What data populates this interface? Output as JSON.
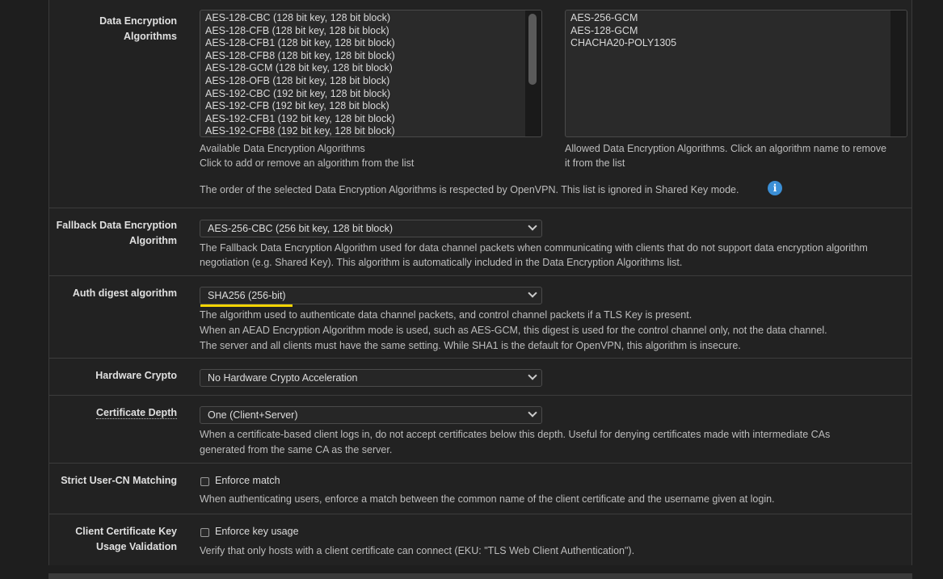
{
  "data_encryption": {
    "label": "Data Encryption Algorithms",
    "available": [
      "AES-128-CBC (128 bit key, 128 bit block)",
      "AES-128-CFB (128 bit key, 128 bit block)",
      "AES-128-CFB1 (128 bit key, 128 bit block)",
      "AES-128-CFB8 (128 bit key, 128 bit block)",
      "AES-128-GCM (128 bit key, 128 bit block)",
      "AES-128-OFB (128 bit key, 128 bit block)",
      "AES-192-CBC (192 bit key, 128 bit block)",
      "AES-192-CFB (192 bit key, 128 bit block)",
      "AES-192-CFB1 (192 bit key, 128 bit block)",
      "AES-192-CFB8 (192 bit key, 128 bit block)"
    ],
    "allowed": [
      "AES-256-GCM",
      "AES-128-GCM",
      "CHACHA20-POLY1305"
    ],
    "available_help_1": "Available Data Encryption Algorithms",
    "available_help_2": "Click to add or remove an algorithm from the list",
    "allowed_help_1": "Allowed Data Encryption Algorithms. Click an algorithm name to remove",
    "allowed_help_2": "it from the list",
    "order_note": "The order of the selected Data Encryption Algorithms is respected by OpenVPN. This list is ignored in Shared Key mode.",
    "info_icon": "i"
  },
  "fallback": {
    "label_1": "Fallback Data Encryption",
    "label_2": "Algorithm",
    "value": "AES-256-CBC (256 bit key, 128 bit block)",
    "help_1": "The Fallback Data Encryption Algorithm used for data channel packets when communicating with clients that do not support data encryption algorithm",
    "help_2": "negotiation (e.g. Shared Key). This algorithm is automatically included in the Data Encryption Algorithms list."
  },
  "auth_digest": {
    "label": "Auth digest algorithm",
    "value": "SHA256 (256-bit)",
    "help_1": "The algorithm used to authenticate data channel packets, and control channel packets if a TLS Key is present.",
    "help_2": "When an AEAD Encryption Algorithm mode is used, such as AES-GCM, this digest is used for the control channel only, not the data channel.",
    "help_3": "The server and all clients must have the same setting. While SHA1 is the default for OpenVPN, this algorithm is insecure."
  },
  "hardware_crypto": {
    "label": "Hardware Crypto",
    "value": "No Hardware Crypto Acceleration"
  },
  "cert_depth": {
    "label": "Certificate Depth",
    "value": "One (Client+Server)",
    "help_1": "When a certificate-based client logs in, do not accept certificates below this depth. Useful for denying certificates made with intermediate CAs",
    "help_2": "generated from the same CA as the server."
  },
  "strict_cn": {
    "label": "Strict User-CN Matching",
    "checkbox_label": "Enforce match",
    "help": "When authenticating users, enforce a match between the common name of the client certificate and the username given at login."
  },
  "client_key_usage": {
    "label_1": "Client Certificate Key",
    "label_2": "Usage Validation",
    "checkbox_label": "Enforce key usage",
    "help": "Verify that only hosts with a client certificate can connect (EKU: \"TLS Web Client Authentication\")."
  },
  "colors": {
    "background": "#1e1e1e",
    "panel": "#222222",
    "highlight_underline": "#f5d400",
    "info_icon": "#3b8fd6"
  }
}
